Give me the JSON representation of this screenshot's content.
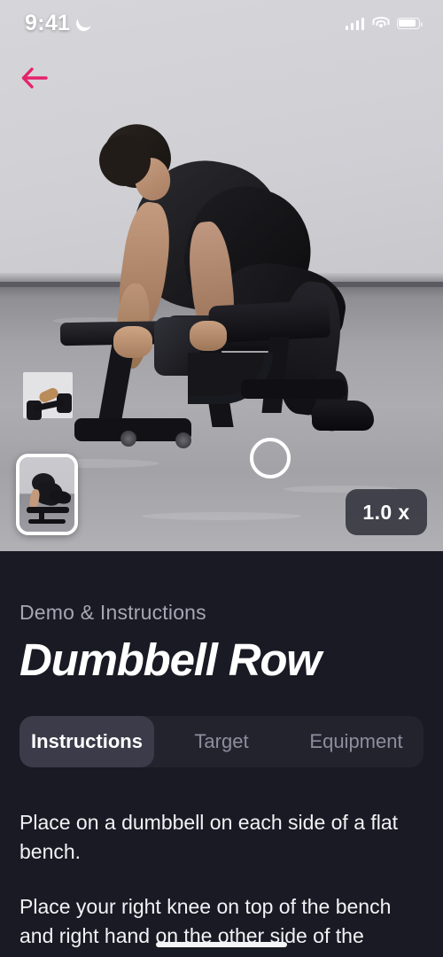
{
  "status_bar": {
    "time": "9:41",
    "dnd_icon": "moon-icon",
    "signal_icon": "cellular-signal-icon",
    "wifi_icon": "wifi-icon",
    "battery_icon": "battery-icon"
  },
  "media": {
    "back_icon": "back-arrow-icon",
    "back_arrow_color": "#E5226B",
    "thumbnail_label": "exercise-preview-thumbnail",
    "record_button_label": "record-button",
    "speed_label": "1.0 x"
  },
  "panel": {
    "eyebrow": "Demo & Instructions",
    "title": "Dumbbell Row",
    "background_color": "#1a1a24",
    "tabs": [
      {
        "label": "Instructions",
        "active": true
      },
      {
        "label": "Target",
        "active": false
      },
      {
        "label": "Equipment",
        "active": false
      }
    ],
    "instructions": [
      "Place on a dumbbell on each side of a flat bench.",
      "Place your right knee on top of the bench and right hand on the other side of the"
    ]
  }
}
